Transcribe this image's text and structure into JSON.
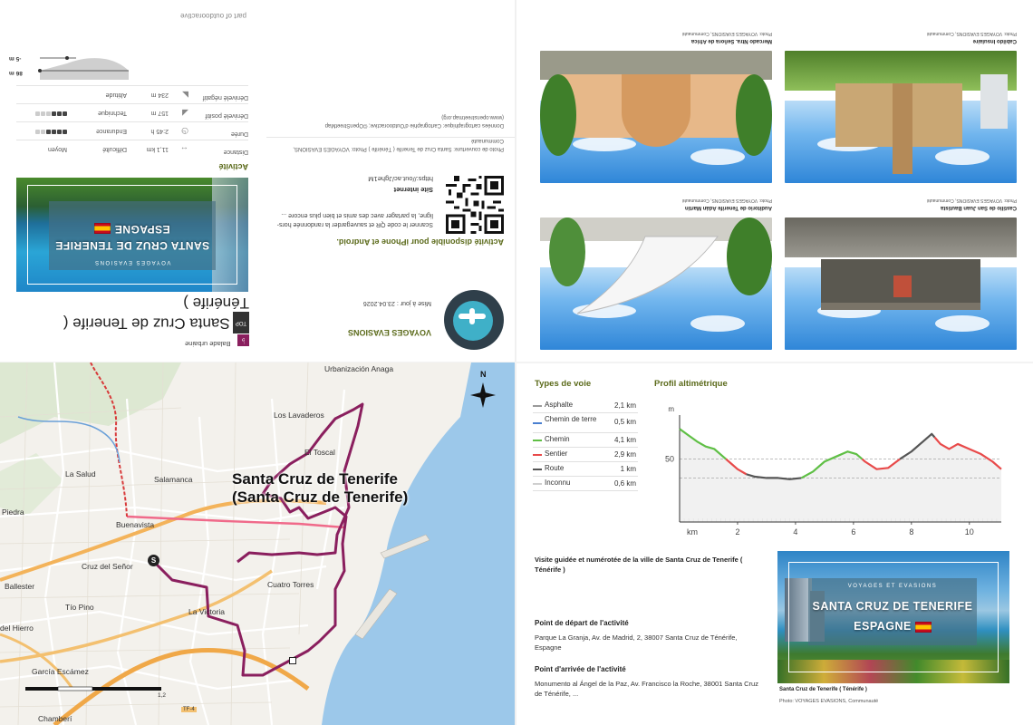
{
  "photos": [
    {
      "caption": "Cabildo Insulaire",
      "credit": "Photo: VOYAGES EVASIONS, Communauté"
    },
    {
      "caption": "Mercado Ntra. Señora de Africa",
      "credit": "Photo: VOYAGES EVASIONS, Communauté"
    },
    {
      "caption": "Castillo de San Juan Bautista",
      "credit": "Photo: VOYAGES EVASIONS, Communauté"
    },
    {
      "caption": "Auditorio de Tenerife Adán Martín",
      "credit": "Photo: VOYAGES EVASIONS, Communauté"
    }
  ],
  "info": {
    "part_of": "part of outdooractive",
    "author": "VOYAGES EVASIONS",
    "updated": "Mise à jour : 23.04.2026",
    "app_title": "Activité disponible pour iPhone et Android.",
    "app_text": "Scanner le code QR et sauvegarder la randonnée hors-ligne, la partager avec des amis et bien plus encore ...",
    "website_label": "Site internet",
    "website_url": "https://out.ac/Jghe1M",
    "cover_credit": "Photo de couverture: Santa Cruz de Tenerife ( Ténérife ) Photo: VOYAGES EVASIONS, Communauté",
    "map_credit": "Données cartographique: Cartographie d'Outdooractive; ©OpenStreetMap (www.openstreetmap.org)",
    "category": "Balade urbaine",
    "top_badge": "TOP",
    "title": "Santa Cruz de Tenerife ( Ténérife )",
    "hero_sub": "VOYAGES EVASIONS",
    "hero_title_1": "SANTA CRUZ DE TENERIFE",
    "hero_title_2": "ESPAGNE"
  },
  "activity": {
    "heading": "Activité",
    "rows": [
      {
        "label": "Distance",
        "value": "11,1 km"
      },
      {
        "label": "Durée",
        "value": "2:45 h"
      },
      {
        "label": "Dénivelé positif",
        "value": "157 m"
      },
      {
        "label": "Dénivelé négatif",
        "value": "234 m"
      }
    ],
    "ratings": [
      {
        "label": "Difficulté",
        "value": "Moyen",
        "level": null
      },
      {
        "label": "Endurance",
        "value": "",
        "level": 4
      },
      {
        "label": "Technique",
        "value": "",
        "level": 3
      },
      {
        "label": "Altitude",
        "value": "",
        "level": null
      }
    ],
    "alt_max": "86 m",
    "alt_min": "-5 m"
  },
  "map": {
    "city_line1": "Santa Cruz de Tenerife",
    "city_line2": "(Santa Cruz de Tenerife)",
    "north": "N",
    "start_marker": "S",
    "labels": [
      {
        "name": "Urbanización Anaga"
      },
      {
        "name": "Los Lavaderos"
      },
      {
        "name": "El Toscal"
      },
      {
        "name": "La Salud"
      },
      {
        "name": "Salamanca"
      },
      {
        "name": "Piedra"
      },
      {
        "name": "Buenavista"
      },
      {
        "name": "Cruz del Señor"
      },
      {
        "name": "Ballester"
      },
      {
        "name": "Tío Pino"
      },
      {
        "name": "Cuatro Torres"
      },
      {
        "name": "La Victoria"
      },
      {
        "name": "del Hierro"
      },
      {
        "name": "García Escámez"
      },
      {
        "name": "Chamberí"
      },
      {
        "name": "TF-4"
      }
    ],
    "scale_label": "1,2"
  },
  "surface": {
    "title": "Types de voie",
    "items": [
      {
        "name": "Asphalte",
        "value": "2,1 km",
        "color": "#9a9a9a"
      },
      {
        "name": "Chemin de terre",
        "value": "0,5 km",
        "color": "#4a7fd0"
      },
      {
        "name": "Chemin",
        "value": "4,1 km",
        "color": "#5fbf45"
      },
      {
        "name": "Sentier",
        "value": "2,9 km",
        "color": "#e84a4a"
      },
      {
        "name": "Route",
        "value": "1 km",
        "color": "#555555"
      },
      {
        "name": "Inconnu",
        "value": "0,6 km",
        "color": "#cfcfcf"
      }
    ]
  },
  "chart_data": {
    "type": "line",
    "title": "Profil altimétrique",
    "xlabel": "km",
    "ylabel": "m",
    "xlim": [
      0,
      11.1
    ],
    "ylim": [
      0,
      85
    ],
    "xticks": [
      2,
      4,
      6,
      8,
      10
    ],
    "yticks": [
      50
    ],
    "x": [
      0,
      0.3,
      0.6,
      0.9,
      1.2,
      1.5,
      1.8,
      2.0,
      2.3,
      2.6,
      3.0,
      3.4,
      3.8,
      4.2,
      4.6,
      5.0,
      5.4,
      5.8,
      6.1,
      6.4,
      6.8,
      7.2,
      7.6,
      8.0,
      8.4,
      8.7,
      9.0,
      9.3,
      9.6,
      10.0,
      10.4,
      10.8,
      11.1
    ],
    "y": [
      74,
      69,
      64,
      60,
      58,
      52,
      46,
      42,
      38,
      36,
      35,
      35,
      34,
      35,
      40,
      48,
      52,
      56,
      54,
      48,
      42,
      43,
      50,
      56,
      64,
      70,
      62,
      58,
      62,
      58,
      54,
      48,
      42
    ],
    "surface_segments": [
      {
        "from": 0,
        "to": 1.6,
        "type": "Chemin"
      },
      {
        "from": 1.6,
        "to": 2.3,
        "type": "Sentier"
      },
      {
        "from": 2.3,
        "to": 4.2,
        "type": "Route"
      },
      {
        "from": 4.2,
        "to": 6.3,
        "type": "Chemin"
      },
      {
        "from": 6.3,
        "to": 7.6,
        "type": "Sentier"
      },
      {
        "from": 7.6,
        "to": 8.8,
        "type": "Route"
      },
      {
        "from": 8.8,
        "to": 11.1,
        "type": "Sentier"
      }
    ]
  },
  "details": {
    "desc": "Visite guidée et numérotée de la ville de Santa Cruz de Tenerife ( Ténérife )",
    "start_title": "Point de départ de l'activité",
    "start_text": "Parque La Granja, Av. de Madrid, 2, 38007 Santa Cruz de Ténérife, Espagne",
    "end_title": "Point d'arrivée de l'activité",
    "end_text": "Monumento al Ángel de la Paz, Av. Francisco la Roche, 38001 Santa Cruz de Ténérife, ...",
    "cover_caption": "Santa Cruz de Tenerife ( Ténérife )",
    "cover_credit": "Photo: VOYAGES EVASIONS, Communauté",
    "hero_sub": "VOYAGES ET EVASIONS",
    "hero_title_1": "SANTA CRUZ DE TENERIFE",
    "hero_title_2": "ESPAGNE"
  },
  "colors": {
    "route": "#8a1f5e",
    "accent_green": "#5b6a1a",
    "sea": "#9cc8ea"
  }
}
